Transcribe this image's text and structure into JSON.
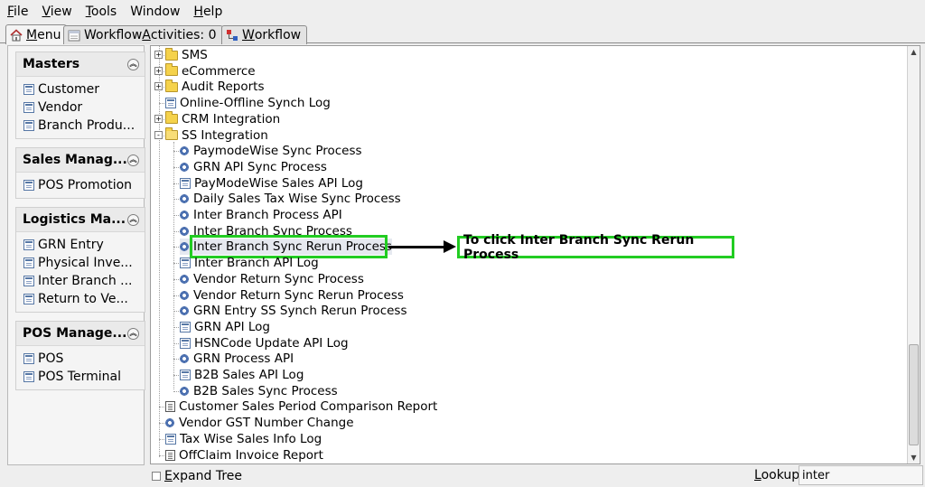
{
  "menubar": {
    "items": [
      {
        "accel": "F",
        "rest": "ile"
      },
      {
        "accel": "V",
        "rest": "iew"
      },
      {
        "accel": "T",
        "rest": "ools"
      },
      {
        "accel": "",
        "rest": "Window"
      },
      {
        "accel": "H",
        "rest": "elp"
      }
    ]
  },
  "tabs": [
    {
      "pre": "",
      "accel": "M",
      "rest": "enu"
    },
    {
      "pre": "Workflow ",
      "accel": "A",
      "rest": "ctivities: 0"
    },
    {
      "pre": "",
      "accel": "W",
      "rest": "orkflow"
    }
  ],
  "sidebar": {
    "sections": [
      {
        "title": "Masters",
        "items": [
          "Customer",
          "Vendor",
          "Branch Produ..."
        ]
      },
      {
        "title": "Sales Manag...",
        "items": [
          "POS Promotion"
        ]
      },
      {
        "title": "Logistics Ma...",
        "items": [
          "GRN Entry",
          "Physical Inve...",
          "Inter Branch ...",
          "Return to Ve..."
        ]
      },
      {
        "title": "POS Manage...",
        "items": [
          "POS",
          "POS Terminal"
        ]
      }
    ]
  },
  "tree": {
    "rows": [
      {
        "label": "SMS",
        "icon": "folder-icon",
        "level": 0,
        "expander": "+"
      },
      {
        "label": "eCommerce",
        "icon": "folder-icon",
        "level": 0,
        "expander": "+"
      },
      {
        "label": "Audit Reports",
        "icon": "folder-icon",
        "level": 0,
        "expander": "+"
      },
      {
        "label": "Online-Offline Synch Log",
        "icon": "form-icon",
        "level": 0,
        "expander": ""
      },
      {
        "label": "CRM Integration",
        "icon": "folder-icon",
        "level": 0,
        "expander": "+"
      },
      {
        "label": "SS Integration",
        "icon": "folder-open-icon",
        "level": 0,
        "expander": "-"
      },
      {
        "label": "PaymodeWise Sync Process",
        "icon": "gear-icon",
        "level": 1,
        "expander": ""
      },
      {
        "label": "GRN API Sync Process",
        "icon": "gear-icon",
        "level": 1,
        "expander": ""
      },
      {
        "label": "PayModeWise Sales API Log",
        "icon": "form-icon",
        "level": 1,
        "expander": ""
      },
      {
        "label": "Daily Sales Tax Wise Sync Process",
        "icon": "gear-icon",
        "level": 1,
        "expander": ""
      },
      {
        "label": "Inter Branch Process API",
        "icon": "gear-icon",
        "level": 1,
        "expander": ""
      },
      {
        "label": "Inter Branch Sync Process",
        "icon": "gear-icon",
        "level": 1,
        "expander": ""
      },
      {
        "label": "Inter Branch Sync Rerun Process",
        "icon": "gear-icon",
        "level": 1,
        "expander": "",
        "selected": true
      },
      {
        "label": "Inter Branch API Log",
        "icon": "form-icon",
        "level": 1,
        "expander": ""
      },
      {
        "label": "Vendor Return Sync Process",
        "icon": "gear-icon",
        "level": 1,
        "expander": ""
      },
      {
        "label": "Vendor Return Sync Rerun Process",
        "icon": "gear-icon",
        "level": 1,
        "expander": ""
      },
      {
        "label": "GRN Entry SS Synch Rerun Process",
        "icon": "gear-icon",
        "level": 1,
        "expander": ""
      },
      {
        "label": "GRN API Log",
        "icon": "form-icon",
        "level": 1,
        "expander": ""
      },
      {
        "label": "HSNCode Update API Log",
        "icon": "form-icon",
        "level": 1,
        "expander": ""
      },
      {
        "label": "GRN Process API",
        "icon": "gear-icon",
        "level": 1,
        "expander": ""
      },
      {
        "label": "B2B Sales API Log",
        "icon": "form-icon",
        "level": 1,
        "expander": ""
      },
      {
        "label": "B2B Sales Sync Process",
        "icon": "gear-icon",
        "level": 1,
        "expander": ""
      },
      {
        "label": "Customer Sales Period Comparison Report",
        "icon": "report-icon",
        "level": 0,
        "expander": ""
      },
      {
        "label": "Vendor GST Number Change",
        "icon": "gear-icon",
        "level": 0,
        "expander": ""
      },
      {
        "label": "Tax Wise Sales Info Log",
        "icon": "form-icon",
        "level": 0,
        "expander": ""
      },
      {
        "label": "OffClaim Invoice Report",
        "icon": "report-icon",
        "level": 0,
        "expander": ""
      }
    ]
  },
  "annotation": {
    "text": "To click Inter Branch Sync Rerun Process"
  },
  "bottom": {
    "expand_tree_pre": "",
    "expand_tree_accel": "E",
    "expand_tree_rest": "xpand Tree",
    "lookup_accel": "L",
    "lookup_rest": "ookup",
    "lookup_value": "inter"
  },
  "colors": {
    "highlight": "#22cc22",
    "folder": "#f5d24b",
    "gear": "#4a6fb0"
  }
}
